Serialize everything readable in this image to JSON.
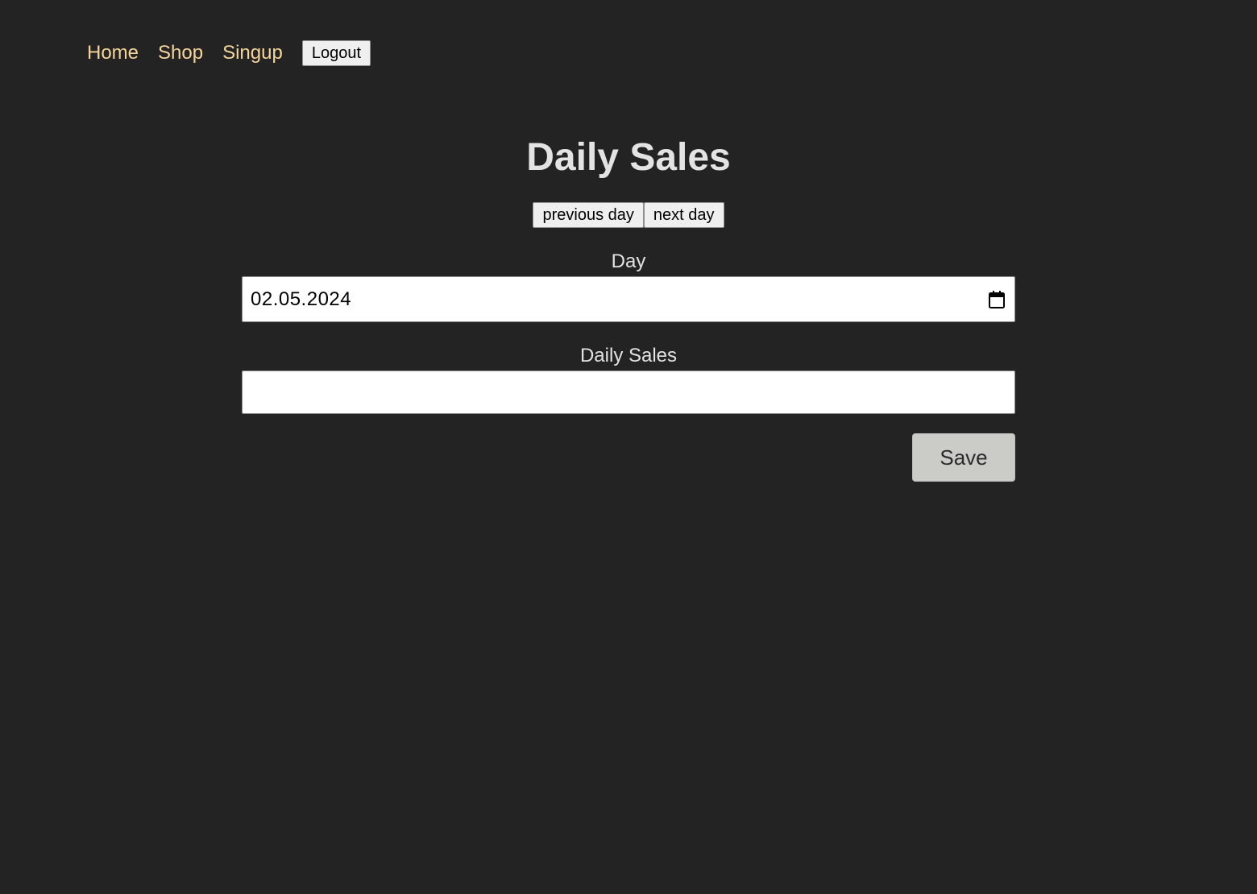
{
  "nav": {
    "home_label": "Home",
    "shop_label": "Shop",
    "signup_label": "Singup",
    "logout_label": "Logout",
    "link_color": "#f5d59a"
  },
  "page": {
    "title": "Daily Sales",
    "background_color": "#232323"
  },
  "day_navigation": {
    "previous_label": "previous day",
    "next_label": "next day"
  },
  "form": {
    "day_label": "Day",
    "day_value": "02.05.2024",
    "day_icon": "calendar-icon",
    "sales_label": "Daily Sales",
    "sales_value": "",
    "save_label": "Save"
  }
}
